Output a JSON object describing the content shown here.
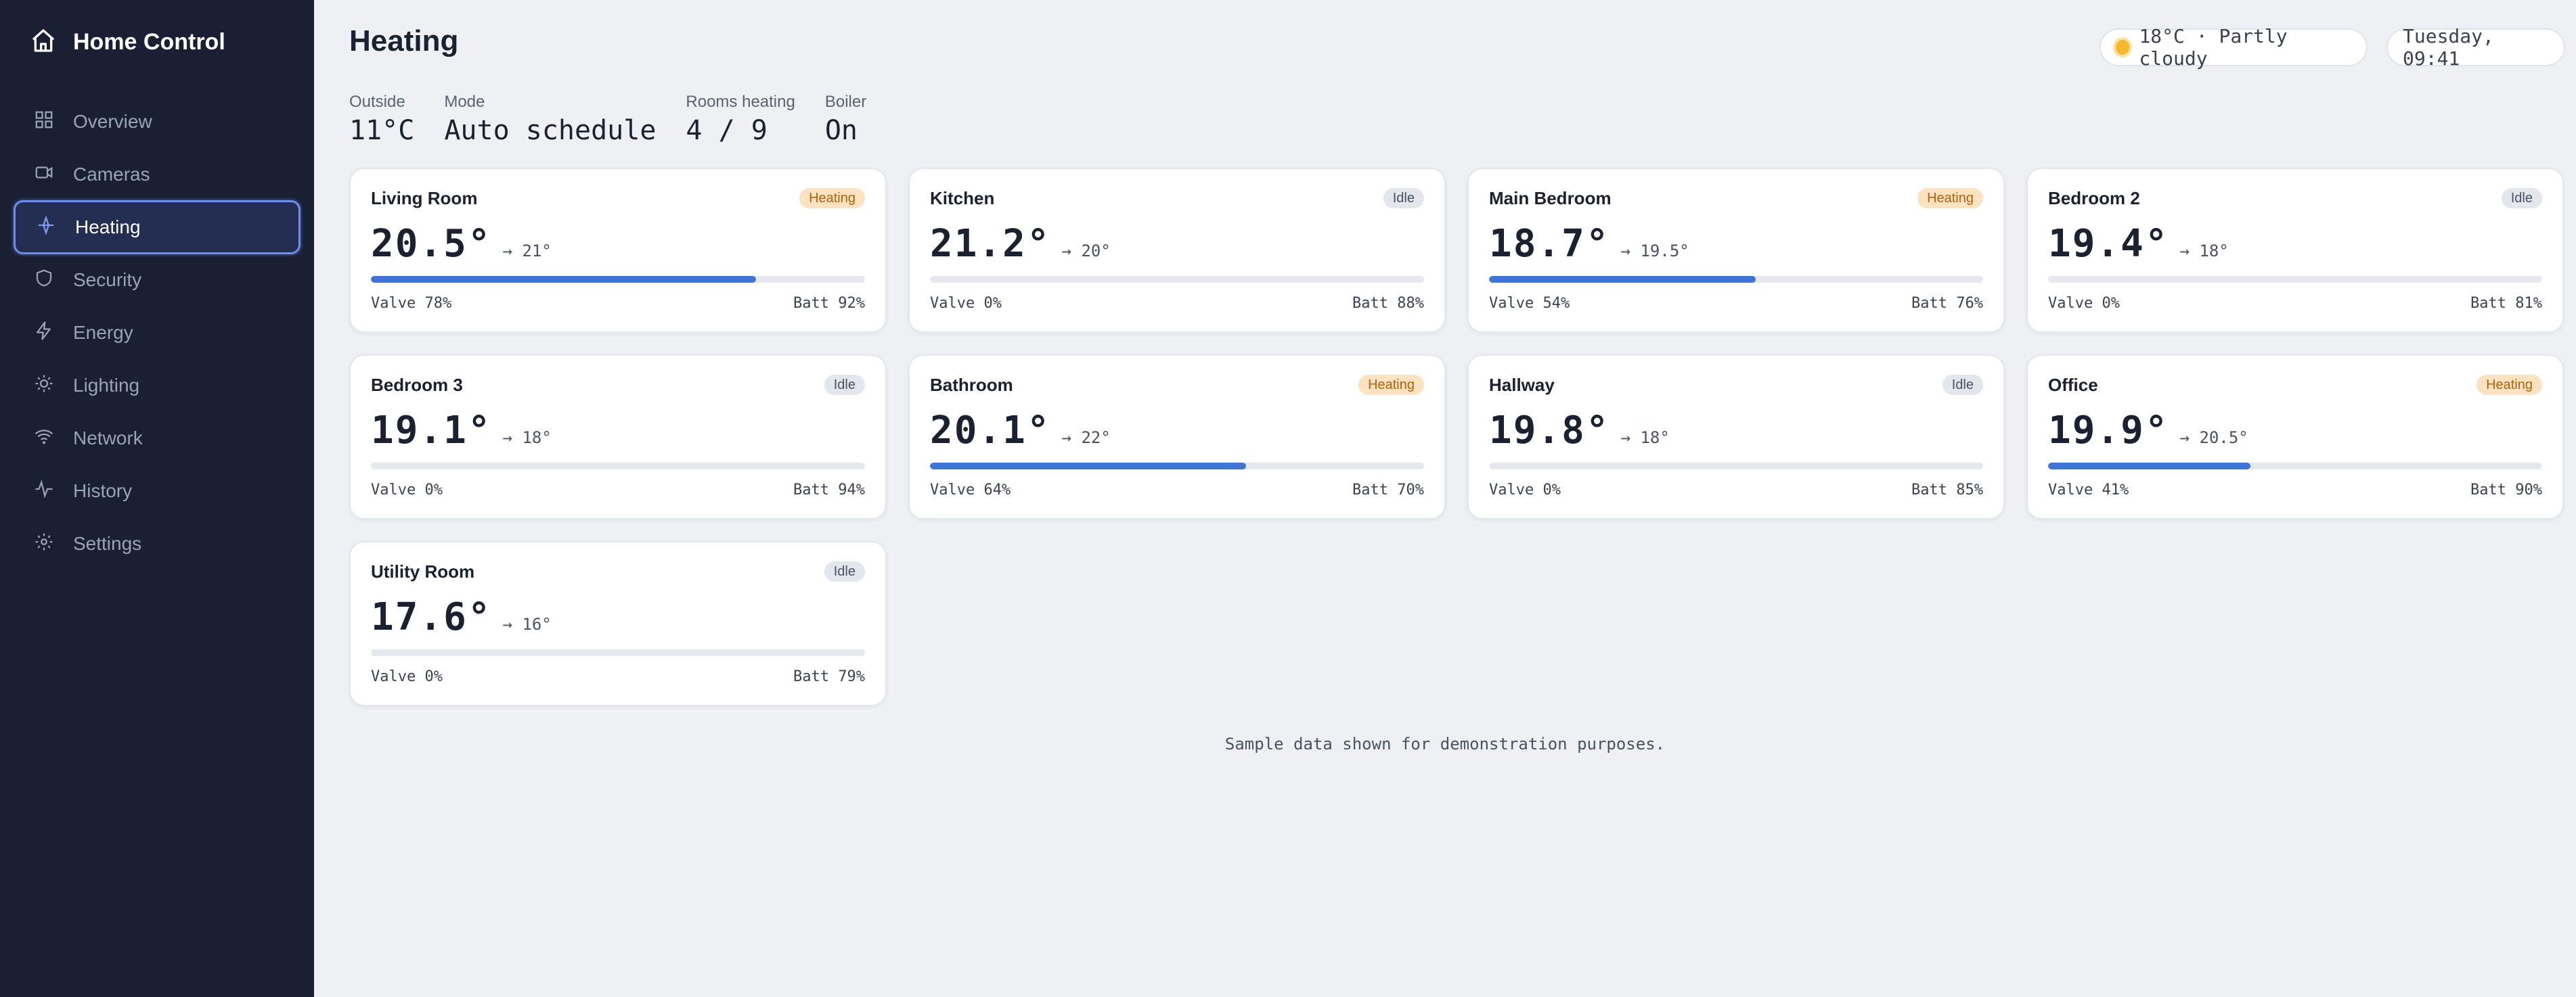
{
  "app": {
    "title": "Home Control"
  },
  "nav": [
    {
      "label": "Overview",
      "icon": "grid-icon",
      "active": false
    },
    {
      "label": "Cameras",
      "icon": "camera-icon",
      "active": false
    },
    {
      "label": "Heating",
      "icon": "heating-icon",
      "active": true
    },
    {
      "label": "Security",
      "icon": "shield-icon",
      "active": false
    },
    {
      "label": "Energy",
      "icon": "bolt-icon",
      "active": false
    },
    {
      "label": "Lighting",
      "icon": "sun-icon",
      "active": false
    },
    {
      "label": "Network",
      "icon": "wifi-icon",
      "active": false
    },
    {
      "label": "History",
      "icon": "activity-icon",
      "active": false
    },
    {
      "label": "Settings",
      "icon": "gear-icon",
      "active": false
    }
  ],
  "header": {
    "title": "Heating",
    "weather": "18°C · Partly cloudy",
    "clock": "Tuesday, 09:41"
  },
  "stats": [
    {
      "label": "Outside",
      "value": "11°C"
    },
    {
      "label": "Mode",
      "value": "Auto schedule"
    },
    {
      "label": "Rooms heating",
      "value": "4 / 9"
    },
    {
      "label": "Boiler",
      "value": "On"
    }
  ],
  "rooms": [
    {
      "name": "Living Room",
      "status": "Heating",
      "temp": "20.5°",
      "target": "→ 21°",
      "valve": "Valve 78%",
      "valve_fraction": 0.78,
      "battery": "Batt 92%"
    },
    {
      "name": "Kitchen",
      "status": "Idle",
      "temp": "21.2°",
      "target": "→ 20°",
      "valve": "Valve 0%",
      "valve_fraction": 0,
      "battery": "Batt 88%"
    },
    {
      "name": "Main Bedroom",
      "status": "Heating",
      "temp": "18.7°",
      "target": "→ 19.5°",
      "valve": "Valve 54%",
      "valve_fraction": 0.54,
      "battery": "Batt 76%"
    },
    {
      "name": "Bedroom 2",
      "status": "Idle",
      "temp": "19.4°",
      "target": "→ 18°",
      "valve": "Valve 0%",
      "valve_fraction": 0,
      "battery": "Batt 81%"
    },
    {
      "name": "Bedroom 3",
      "status": "Idle",
      "temp": "19.1°",
      "target": "→ 18°",
      "valve": "Valve 0%",
      "valve_fraction": 0,
      "battery": "Batt 94%"
    },
    {
      "name": "Bathroom",
      "status": "Heating",
      "temp": "20.1°",
      "target": "→ 22°",
      "valve": "Valve 64%",
      "valve_fraction": 0.64,
      "battery": "Batt 70%"
    },
    {
      "name": "Hallway",
      "status": "Idle",
      "temp": "19.8°",
      "target": "→ 18°",
      "valve": "Valve 0%",
      "valve_fraction": 0,
      "battery": "Batt 85%"
    },
    {
      "name": "Office",
      "status": "Heating",
      "temp": "19.9°",
      "target": "→ 20.5°",
      "valve": "Valve 41%",
      "valve_fraction": 0.41,
      "battery": "Batt 90%"
    },
    {
      "name": "Utility Room",
      "status": "Idle",
      "temp": "17.6°",
      "target": "→ 16°",
      "valve": "Valve 0%",
      "valve_fraction": 0,
      "battery": "Batt 79%"
    }
  ],
  "footnote": "Sample data shown for demonstration purposes.",
  "colors": {
    "accent": "#3f74d6",
    "sidebar": "#1a1f33",
    "heating_badge": "#fbe3c2",
    "idle_badge": "#e3e6ec"
  }
}
